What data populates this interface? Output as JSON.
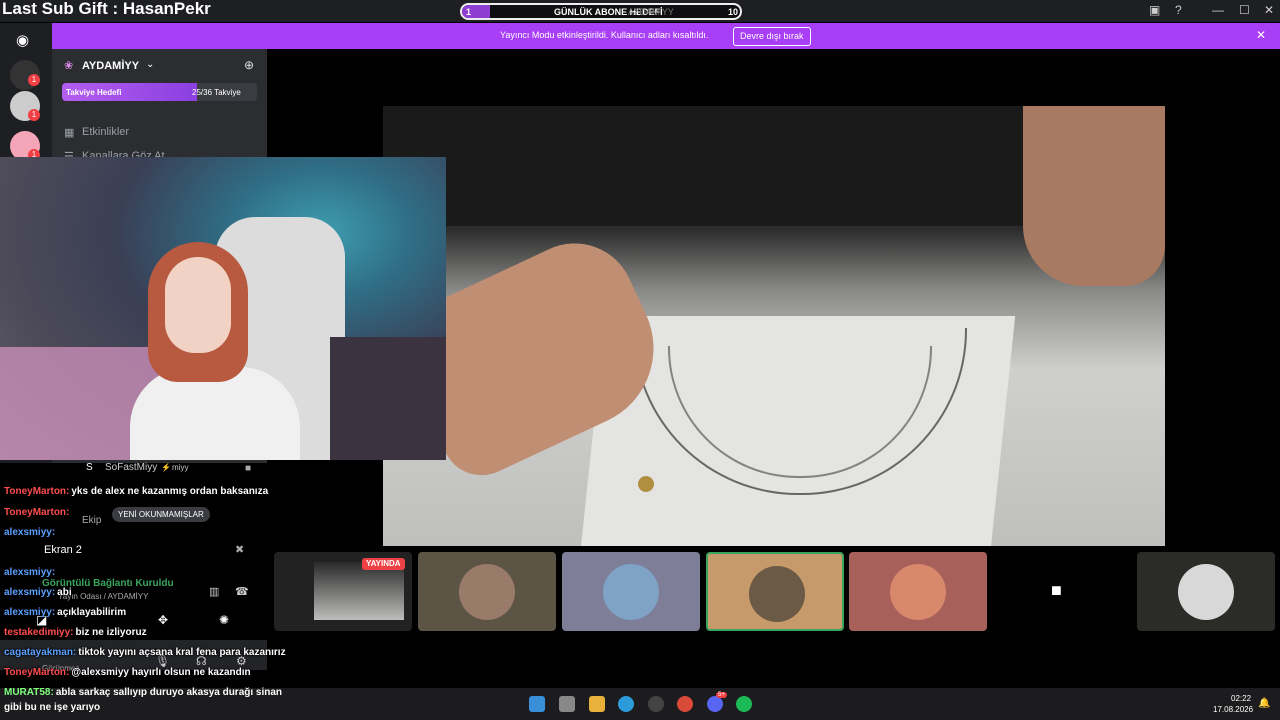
{
  "overlay": {
    "last_sub_gift": "Last Sub Gift : HasanPekr",
    "goal": {
      "label": "GÜNLÜK ABONE HEDEFİ",
      "current": "1",
      "target": "10",
      "progress": 0.1
    },
    "watermark": "AYDAMİYY"
  },
  "banner": {
    "text": "Yayıncı Modu etkinleştirildi. Kullanıcı adları kısaltıldı.",
    "button": "Devre dışı bırak",
    "close_icon": "close-icon"
  },
  "rail": {
    "badges": [
      "1",
      "1",
      "1"
    ]
  },
  "sidebar": {
    "server_name": "AYDAMİYY",
    "boost_label": "Takviye Hedefi",
    "boost_count": "25/36 Takviye",
    "boost_progress": 0.69,
    "channels": [
      "Etkinlikler",
      "Kanallara Göz At"
    ],
    "voice_user": "SoFastMiyy",
    "voice_tag": "miyy",
    "ekip": "Ekip",
    "unread": "YENİ OKUNMAMIŞLAR",
    "screen_label": "Ekran 2",
    "conn_status": "Görüntülü Bağlantı Kuruldu",
    "conn_detail": "Yayın Odası / AYDAMİYY",
    "user_status": "Görünmez"
  },
  "chat": [
    {
      "user": "ToneyMarton:",
      "text": "yks de alex ne kazanmış ordan baksanıza",
      "color": "#ff4d4d"
    },
    {
      "user": "ToneyMarton:",
      "text": "",
      "color": "#ff4d4d"
    },
    {
      "user": "alexsmiyy:",
      "text": "",
      "color": "#5aa0ff"
    },
    {
      "user": "alexsmiyy:",
      "text": "",
      "color": "#5aa0ff"
    },
    {
      "user": "alexsmiyy:",
      "text": "abi",
      "color": "#5aa0ff"
    },
    {
      "user": "alexsmiyy:",
      "text": "açıklayabilirim",
      "color": "#5aa0ff"
    },
    {
      "user": "testakedimiyy:",
      "text": "biz ne izliyoruz",
      "color": "#ff4d4d"
    },
    {
      "user": "cagatayakman:",
      "text": "tiktok yayını açsana kral fena para kazanırız",
      "color": "#5aa0ff"
    },
    {
      "user": "ToneyMarton:",
      "text": "@alexsmiyy hayırlı olsun ne kazandın",
      "color": "#ff4d4d"
    },
    {
      "user": "MURAT58:",
      "text": "abla sarkaç sallıyıp duruyo akasya durağı sinan",
      "color": "#7cff7c"
    },
    {
      "user": "",
      "text": "gibi bu ne işe yarıyo",
      "color": "#fff"
    }
  ],
  "tiles": {
    "live_badge": "YAYINDA",
    "colors": [
      "#5c5546",
      "#7e7e98",
      "#c79a6b",
      "#a8605a",
      "#000000",
      "#2b2b27"
    ]
  },
  "taskbar": {
    "time": "02:22",
    "date": "17.08.2026",
    "discord_badge": "5+"
  },
  "colors": {
    "accent": "#a83ef5",
    "discord_bg": "#2b2d31",
    "rail_bg": "#1e1f22"
  }
}
